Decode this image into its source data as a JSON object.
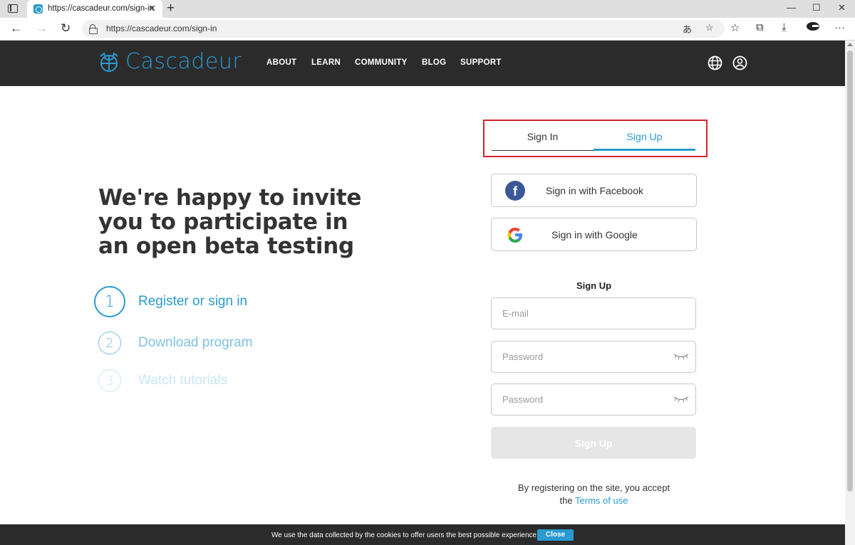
{
  "browser": {
    "tab_title": "https://cascadeur.com/sign-in",
    "tab_close": "✕",
    "new_tab": "+",
    "url": "https://cascadeur.com/sign-in",
    "minimize": "—",
    "maximize": "☐",
    "close": "✕"
  },
  "header": {
    "logo_text": "Cascadeur",
    "nav": [
      "ABOUT",
      "LEARN",
      "COMMUNITY",
      "BLOG",
      "SUPPORT"
    ]
  },
  "hero": {
    "headline": "We're happy to invite you to participate in an open beta testing",
    "steps": [
      {
        "number": "1",
        "label": "Register or sign in"
      },
      {
        "number": "2",
        "label": "Download program"
      },
      {
        "number": "3",
        "label": "Watch tutorials"
      }
    ]
  },
  "auth": {
    "tabs": {
      "sign_in": "Sign In",
      "sign_up": "Sign Up",
      "active": "sign_up"
    },
    "facebook_label": "Sign in with Facebook",
    "google_label": "Sign in with Google",
    "form_title": "Sign Up",
    "email_placeholder": "E-mail",
    "password_placeholder": "Password",
    "password_confirm_placeholder": "Password",
    "submit_label": "Sign Up",
    "terms_prefix": "By registering on the site, you accept",
    "terms_the": "the",
    "terms_link": "Terms of use"
  },
  "cookie": {
    "text": "We use the data collected by the cookies to offer users the best possible experience",
    "button": "Close"
  },
  "colors": {
    "accent": "#2a9ad0",
    "header_bg": "#2b2b2b",
    "highlight_box": "#d2232a"
  }
}
